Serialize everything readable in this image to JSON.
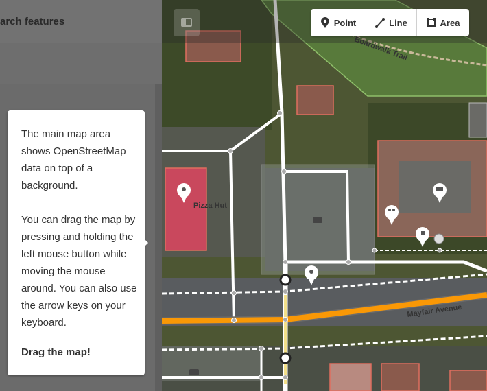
{
  "sidebar": {
    "search_text": "arch features"
  },
  "toolbar": {
    "modes": [
      {
        "label": "Point",
        "icon": "point-pin-icon"
      },
      {
        "label": "Line",
        "icon": "line-icon"
      },
      {
        "label": "Area",
        "icon": "area-icon"
      }
    ]
  },
  "tooltip": {
    "paragraph1": "The main map area shows OpenStreetMap data on top of a background.",
    "paragraph2": "You can drag the map by pressing and holding the left mouse button while moving the mouse around. You can also use the arrow keys on your keyboard.",
    "action": "Drag the map!"
  },
  "map": {
    "labels": {
      "pizza_hut": "Pizza Hut",
      "mayfair_avenue": "Mayfair Avenue",
      "boardwalk_trail": "Boardwalk Trail"
    }
  },
  "colors": {
    "primary_road": "#f99806",
    "service_road": "#ffffff",
    "building_highlight": "#e06e5f"
  }
}
